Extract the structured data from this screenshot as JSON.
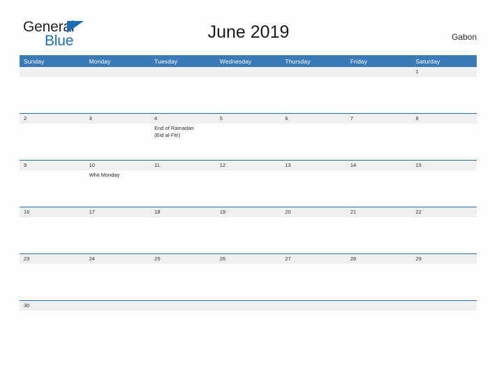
{
  "brand": {
    "word_one": "General",
    "word_two": "Blue",
    "flag_icon": "triangle-flag-icon",
    "accent_color": "#1c6cb4"
  },
  "header": {
    "title": "June 2019",
    "locale": "Gabon"
  },
  "theme": {
    "header_blue": "#3a7ab9",
    "divider_blue": "#2e6ca8",
    "date_band_gray": "#f0f0f0",
    "page_background": "#fdfdfd"
  },
  "calendar": {
    "weekdays": [
      "Sunday",
      "Monday",
      "Tuesday",
      "Wednesday",
      "Thursday",
      "Friday",
      "Saturday"
    ],
    "weeks": [
      {
        "days": [
          {
            "date": "",
            "events": []
          },
          {
            "date": "",
            "events": []
          },
          {
            "date": "",
            "events": []
          },
          {
            "date": "",
            "events": []
          },
          {
            "date": "",
            "events": []
          },
          {
            "date": "",
            "events": []
          },
          {
            "date": "1",
            "events": []
          }
        ]
      },
      {
        "days": [
          {
            "date": "2",
            "events": []
          },
          {
            "date": "3",
            "events": []
          },
          {
            "date": "4",
            "events": [
              "End of Ramadan",
              "(Eid al-Fitr)"
            ]
          },
          {
            "date": "5",
            "events": []
          },
          {
            "date": "6",
            "events": []
          },
          {
            "date": "7",
            "events": []
          },
          {
            "date": "8",
            "events": []
          }
        ]
      },
      {
        "days": [
          {
            "date": "9",
            "events": []
          },
          {
            "date": "10",
            "events": [
              "Whit Monday"
            ]
          },
          {
            "date": "11",
            "events": []
          },
          {
            "date": "12",
            "events": []
          },
          {
            "date": "13",
            "events": []
          },
          {
            "date": "14",
            "events": []
          },
          {
            "date": "15",
            "events": []
          }
        ]
      },
      {
        "days": [
          {
            "date": "16",
            "events": []
          },
          {
            "date": "17",
            "events": []
          },
          {
            "date": "18",
            "events": []
          },
          {
            "date": "19",
            "events": []
          },
          {
            "date": "20",
            "events": []
          },
          {
            "date": "21",
            "events": []
          },
          {
            "date": "22",
            "events": []
          }
        ]
      },
      {
        "days": [
          {
            "date": "23",
            "events": []
          },
          {
            "date": "24",
            "events": []
          },
          {
            "date": "25",
            "events": []
          },
          {
            "date": "26",
            "events": []
          },
          {
            "date": "27",
            "events": []
          },
          {
            "date": "28",
            "events": []
          },
          {
            "date": "29",
            "events": []
          }
        ]
      },
      {
        "days": [
          {
            "date": "30",
            "events": []
          },
          {
            "date": "",
            "events": []
          },
          {
            "date": "",
            "events": []
          },
          {
            "date": "",
            "events": []
          },
          {
            "date": "",
            "events": []
          },
          {
            "date": "",
            "events": []
          },
          {
            "date": "",
            "events": []
          }
        ]
      }
    ]
  }
}
